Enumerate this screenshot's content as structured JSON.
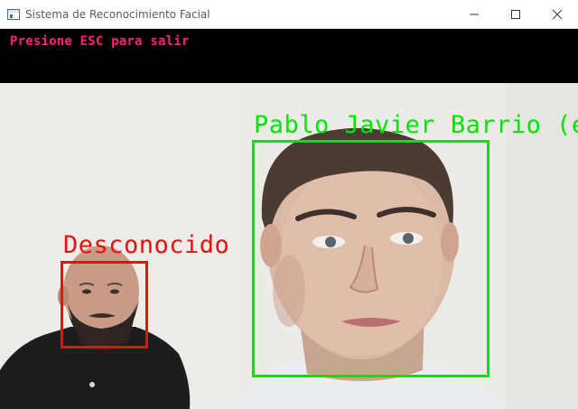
{
  "window": {
    "title": "Sistema de Reconocimiento Facial"
  },
  "overlay": {
    "instruction": "Presione ESC para salir",
    "instruction_color": "#ff1f7a"
  },
  "detections": [
    {
      "label": "Pablo Javier Barrio (el de",
      "color": "#00e600"
    },
    {
      "label": "Desconocido",
      "color": "#e81010"
    }
  ],
  "icons": {
    "app": "window-app-icon",
    "minimize": "minimize-icon",
    "maximize": "maximize-icon",
    "close": "close-icon"
  }
}
